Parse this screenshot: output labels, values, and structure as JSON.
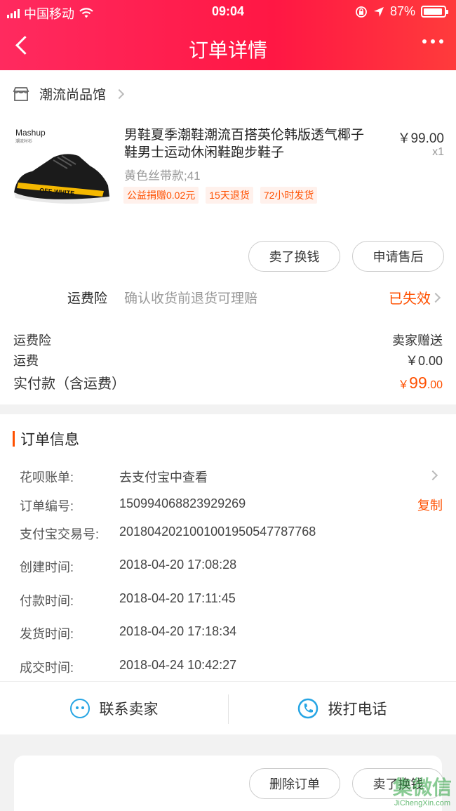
{
  "status_bar": {
    "carrier": "中国移动",
    "time": "09:04",
    "battery": "87%"
  },
  "header": {
    "title": "订单详情"
  },
  "shop": {
    "name": "潮流尚品馆"
  },
  "product": {
    "brand": "Mashup",
    "brand_sub": "潮流衬衫",
    "title": "男鞋夏季潮鞋潮流百搭英伦韩版透气椰子鞋男士运动休闲鞋跑步鞋子",
    "price": "￥99.00",
    "qty": "x1",
    "variant": "黄色丝带款;41",
    "tags": [
      "公益捐赠0.02元",
      "15天退货",
      "72小时发货"
    ]
  },
  "item_actions": {
    "sell": "卖了换钱",
    "after_sale": "申请售后"
  },
  "insurance": {
    "label": "运费险",
    "desc": "确认收货前退货可理赔",
    "status": "已失效"
  },
  "fees": {
    "insurance_label": "运费险",
    "insurance_value": "卖家赠送",
    "shipping_label": "运费",
    "shipping_value": "￥0.00",
    "paid_label": "实付款（含运费）",
    "paid_currency": "￥",
    "paid_int": "99",
    "paid_dec": ".00"
  },
  "order_info": {
    "title": "订单信息",
    "huabei_label": "花呗账单:",
    "huabei_value": "去支付宝中查看",
    "order_no_label": "订单编号:",
    "order_no": "150994068823929269",
    "copy": "复制",
    "alipay_label": "支付宝交易号:",
    "alipay_no": "2018042021001001950547787768",
    "created_label": "创建时间:",
    "created": "2018-04-20 17:08:28",
    "paid_label": "付款时间:",
    "paid": "2018-04-20 17:11:45",
    "shipped_label": "发货时间:",
    "shipped": "2018-04-20 17:18:34",
    "closed_label": "成交时间:",
    "closed": "2018-04-24 10:42:27"
  },
  "contact": {
    "seller": "联系卖家",
    "call": "拨打电话"
  },
  "bottom": {
    "delete": "删除订单",
    "sell": "卖了换钱",
    "watermark": "集微信",
    "watermark_url": "JiChengXin.com"
  },
  "colors": {
    "header": "#ff1744",
    "accent": "#ff5000",
    "icon_blue": "#26a5e4"
  }
}
